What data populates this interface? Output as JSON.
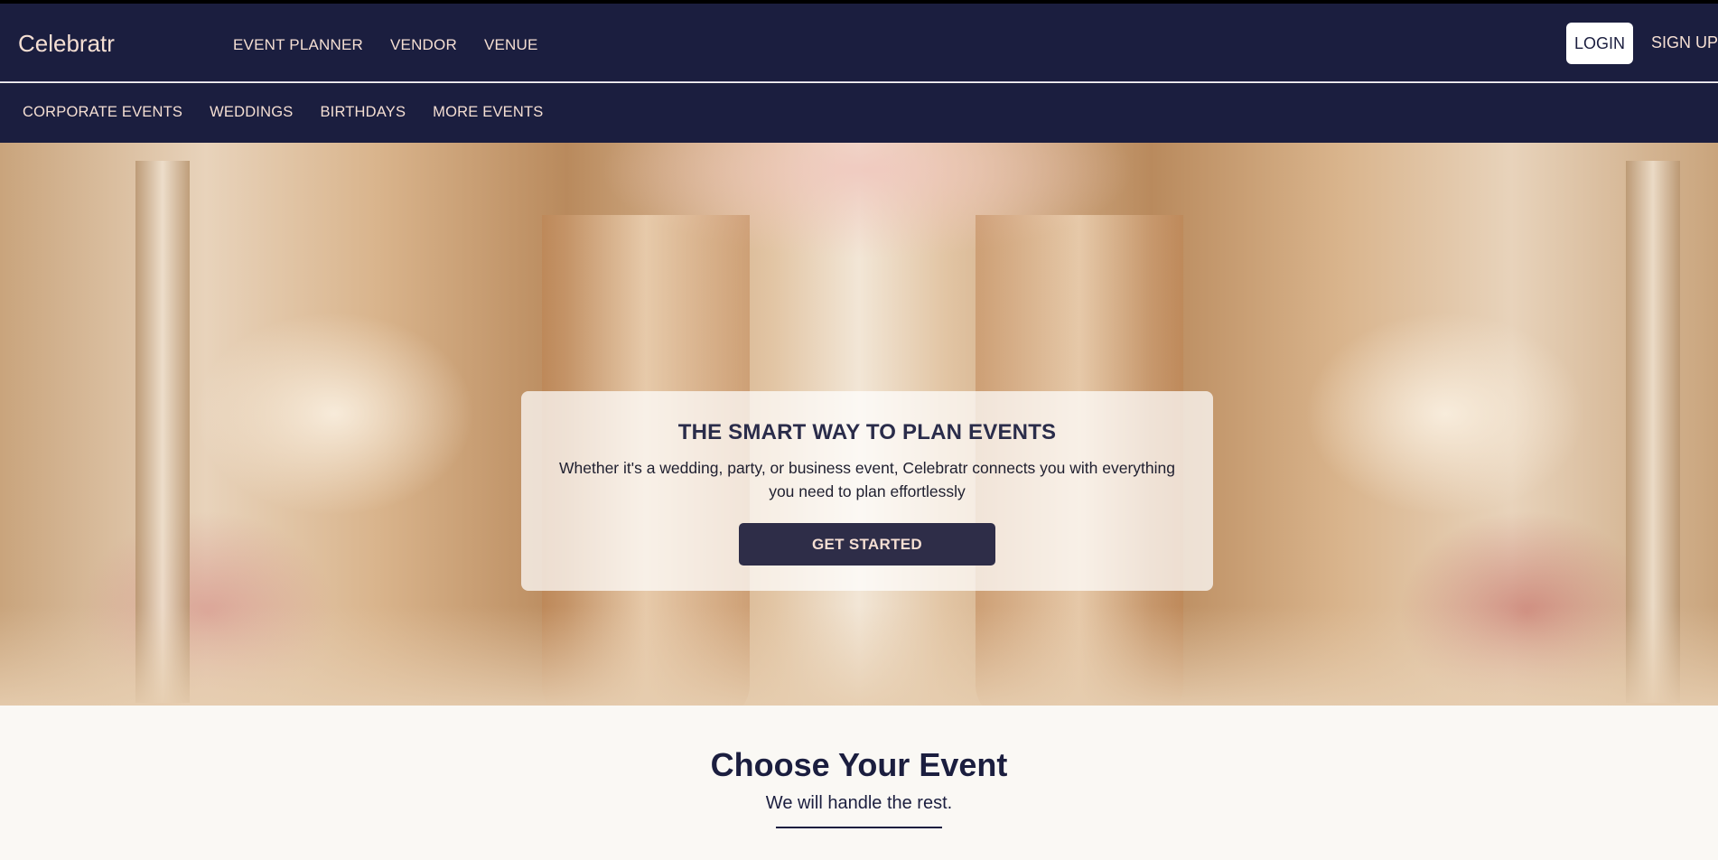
{
  "brand": {
    "name": "Celebratr"
  },
  "main_nav": [
    "EVENT PLANNER",
    "VENDOR",
    "VENUE"
  ],
  "auth": {
    "login": "LOGIN",
    "signup": "SIGN UP"
  },
  "sub_nav": [
    "CORPORATE EVENTS",
    "WEDDINGS",
    "BIRTHDAYS",
    "MORE EVENTS"
  ],
  "hero": {
    "title": "THE SMART WAY TO PLAN EVENTS",
    "text": "Whether it's a wedding, party, or business event, Celebratr connects you with everything you need to plan effortlessly",
    "cta": "GET STARTED"
  },
  "events": {
    "title": "Choose Your Event",
    "subtitle": "We will handle the rest."
  },
  "colors": {
    "nav_bg": "#1b1e3f",
    "nav_text": "#f5dfd3",
    "cta_bg": "#2e2d48",
    "page_bg": "#faf8f4"
  }
}
